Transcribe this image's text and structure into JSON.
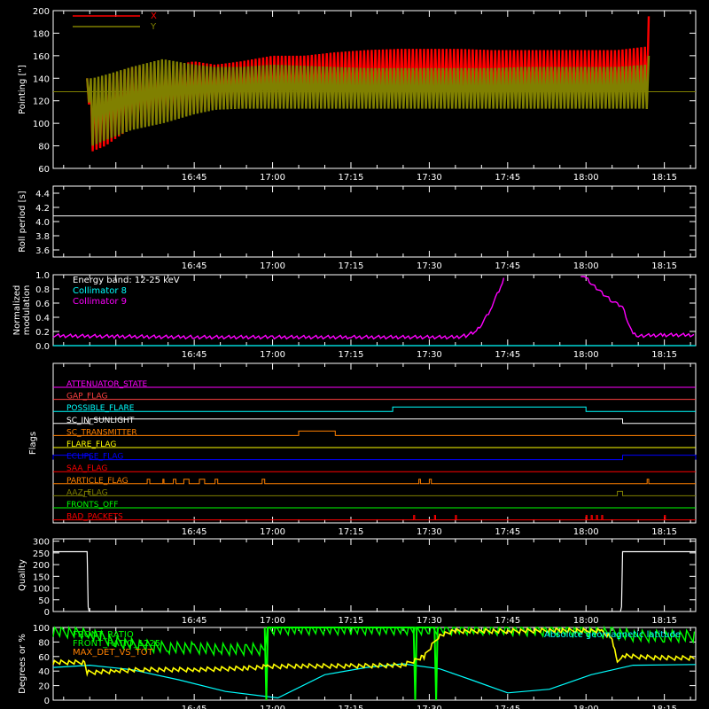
{
  "time_axis": {
    "range_min": [
      -27,
      96
    ],
    "ticks": [
      "16:45",
      "17:00",
      "17:15",
      "17:30",
      "17:45",
      "18:00",
      "18:15"
    ],
    "tick_min": [
      0,
      15,
      30,
      45,
      60,
      75,
      90
    ],
    "minor_step_min": 5
  },
  "colors": {
    "background": "#000000",
    "axes": "#ffffff",
    "x_pointing": "#ff0000",
    "y_pointing": "#808000",
    "cyan": "#00ffff",
    "magenta": "#ff00ff",
    "yellow": "#ffff00",
    "green": "#00ff00",
    "orange": "#ff8000"
  },
  "chart_data": [
    {
      "type": "line",
      "panel": "pointing",
      "ylabel": "Pointing [\"]",
      "ylim": [
        60,
        200
      ],
      "yticks": [
        60,
        80,
        100,
        120,
        140,
        160,
        180,
        200
      ],
      "legend_position": "top-left",
      "series": [
        {
          "name": "X",
          "color": "#ff0000",
          "envelope_x": [
            -20.5,
            -19.5,
            -17,
            -12,
            -6,
            0,
            4,
            9,
            15,
            21,
            27,
            33,
            39,
            45,
            51,
            57,
            63,
            69,
            75,
            81,
            86.5,
            87
          ],
          "envelope_upper": [
            140,
            130,
            140,
            150,
            150,
            155,
            152,
            155,
            160,
            160,
            163,
            165,
            166,
            166,
            166,
            165,
            165,
            165,
            165,
            165,
            168,
            195
          ],
          "envelope_lower": [
            140,
            75,
            80,
            96,
            105,
            110,
            115,
            116,
            117,
            118,
            118,
            118,
            119,
            119,
            119,
            119,
            119,
            118,
            117,
            118,
            118,
            112
          ],
          "baseline": 128
        },
        {
          "name": "Y",
          "color": "#808000",
          "envelope_x": [
            -20.5,
            -19.5,
            -17,
            -12,
            -6,
            0,
            4,
            9,
            15,
            21,
            27,
            33,
            39,
            45,
            51,
            57,
            63,
            69,
            75,
            81,
            86.5,
            87
          ],
          "envelope_upper": [
            140,
            140,
            143,
            150,
            157,
            152,
            150,
            150,
            152,
            151,
            150,
            149,
            149,
            149,
            149,
            149,
            150,
            150,
            150,
            150,
            152,
            160
          ],
          "envelope_lower": [
            140,
            80,
            85,
            94,
            100,
            108,
            112,
            113,
            113,
            113,
            113,
            113,
            113,
            113,
            113,
            113,
            113,
            113,
            113,
            113,
            113,
            112
          ],
          "baseline": 128
        }
      ]
    },
    {
      "type": "line",
      "panel": "roll_period",
      "ylabel": "Roll period [s]",
      "ylim": [
        3.5,
        4.5
      ],
      "yticks": [
        3.6,
        3.8,
        4.0,
        4.2,
        4.4
      ],
      "series": [
        {
          "color": "#ffffff",
          "x": [
            -27,
            96
          ],
          "y": [
            4.08,
            4.08
          ]
        }
      ]
    },
    {
      "type": "line",
      "panel": "modulation",
      "ylabel": "Normalized modulation",
      "ylim": [
        0,
        1.0
      ],
      "yticks": [
        0.0,
        0.2,
        0.4,
        0.6,
        0.8,
        1.0
      ],
      "annotations": [
        "Energy band: 12-25 keV"
      ],
      "legend_position": "top-left",
      "series": [
        {
          "name": "Collimator 8",
          "color": "#00ffff",
          "x": [
            -27,
            96
          ],
          "y": [
            0.0,
            0.0
          ]
        },
        {
          "name": "Collimator 9",
          "color": "#ff00ff",
          "segments": [
            {
              "x": [
                -27,
                -15,
                0,
                15,
                30,
                40,
                50,
                52,
                54,
                55,
                56,
                57,
                58,
                59,
                59.5
              ],
              "y": [
                0.14,
                0.13,
                0.12,
                0.12,
                0.12,
                0.12,
                0.12,
                0.14,
                0.2,
                0.3,
                0.42,
                0.55,
                0.72,
                0.88,
                1.0
              ]
            },
            {
              "x": [
                74,
                75,
                76,
                78,
                80,
                81,
                82,
                83,
                84,
                85,
                90,
                96
              ],
              "y": [
                1.0,
                0.95,
                0.88,
                0.75,
                0.62,
                0.58,
                0.55,
                0.35,
                0.16,
                0.14,
                0.15,
                0.15
              ]
            }
          ]
        }
      ]
    },
    {
      "type": "line",
      "panel": "flags",
      "ylabel": "Flags",
      "flags": [
        {
          "name": "ATTENUATOR_STATE",
          "color": "#ff00ff",
          "changes": []
        },
        {
          "name": "GAP_FLAG",
          "color": "#ff4040",
          "changes": []
        },
        {
          "name": "POSSIBLE_FLARE",
          "color": "#00ffff",
          "changes": [
            [
              38,
              75
            ]
          ]
        },
        {
          "name": "SC_IN_SUNLIGHT",
          "color": "#ffffff",
          "changes": [
            [
              -20,
              82
            ]
          ]
        },
        {
          "name": "SC_TRANSMITTER",
          "color": "#ff8000",
          "changes": [
            [
              20,
              27
            ]
          ]
        },
        {
          "name": "FLARE_FLAG",
          "color": "#ffff00",
          "changes": []
        },
        {
          "name": "ECLIPSE_FLAG",
          "color": "#0000ff",
          "changes": [
            [
              -27,
              -20
            ],
            [
              82,
              96
            ]
          ]
        },
        {
          "name": "SAA_FLAG",
          "color": "#ff0000",
          "changes": []
        },
        {
          "name": "PARTICLE_FLAG",
          "color": "#ff8000",
          "changes": [
            [
              -9,
              -8.5
            ],
            [
              -6,
              -5.8
            ],
            [
              -4,
              -3.5
            ],
            [
              -2,
              -1
            ],
            [
              1,
              2
            ],
            [
              4,
              4.5
            ],
            [
              13,
              13.5
            ],
            [
              43,
              43.3
            ],
            [
              45,
              45.4
            ],
            [
              86.7,
              87
            ]
          ]
        },
        {
          "name": "AAZ_FLAG",
          "color": "#808000",
          "changes": [
            [
              -21,
              -20
            ],
            [
              81,
              82
            ]
          ]
        },
        {
          "name": "FRONTS_OFF",
          "color": "#00ff00",
          "changes": []
        },
        {
          "name": "BAD_PACKETS",
          "color": "#ff0000",
          "changes": [
            [
              42,
              42.2
            ],
            [
              46,
              46.2
            ],
            [
              50,
              50.2
            ],
            [
              75,
              75.2
            ],
            [
              76,
              76.2
            ],
            [
              77,
              77.2
            ],
            [
              78,
              78.2
            ],
            [
              90,
              90.2
            ]
          ]
        }
      ]
    },
    {
      "type": "line",
      "panel": "quality",
      "ylabel": "Quality",
      "ylim": [
        0,
        310
      ],
      "yticks": [
        0,
        50,
        100,
        150,
        200,
        250,
        300
      ],
      "series": [
        {
          "color": "#ffffff",
          "x": [
            -27,
            -20.5,
            -20.3,
            -20.1,
            81.6,
            81.8,
            82,
            96
          ],
          "y": [
            255,
            255,
            20,
            0,
            0,
            20,
            255,
            255
          ]
        }
      ]
    },
    {
      "type": "line",
      "panel": "ratios",
      "ylabel": "Degrees or %",
      "ylim": [
        0,
        100
      ],
      "yticks": [
        0,
        20,
        40,
        60,
        80,
        100
      ],
      "legend_position": "top-left",
      "right_label": "Absolute geomagnetic latitude",
      "series": [
        {
          "name": "FRONT_RATIO",
          "color": "#00ff00",
          "x": [
            -27,
            -20,
            -15,
            -10,
            -5,
            0,
            5,
            10,
            13.5,
            14,
            20,
            30,
            40,
            45,
            50,
            55,
            60,
            65,
            70,
            75,
            80,
            85,
            90,
            96
          ],
          "y": [
            95,
            92,
            80,
            75,
            72,
            72,
            70,
            70,
            70,
            98,
            98,
            98,
            98,
            98,
            98,
            98,
            97,
            96,
            96,
            95,
            93,
            88,
            88,
            88
          ]
        },
        {
          "name": "FRONT_RATIO_1225",
          "color": "#00ff00",
          "x": [
            13.5,
            13.8,
            14.1,
            42,
            42.3,
            42.6,
            46,
            46.3,
            46.6
          ],
          "y": [
            100,
            0,
            100,
            100,
            0,
            100,
            100,
            0,
            100
          ]
        },
        {
          "name": "MAX_DET_VS_TOT",
          "color": "#ffff00",
          "x": [
            -27,
            -21,
            -20.5,
            -15,
            -10,
            0,
            10,
            14,
            20,
            30,
            40,
            44,
            47,
            50,
            60,
            70,
            78,
            80,
            81,
            82,
            84,
            90,
            96
          ],
          "y": [
            52,
            52,
            38,
            40,
            42,
            42,
            44,
            46,
            47,
            47,
            48,
            60,
            90,
            95,
            95,
            96,
            95,
            85,
            50,
            62,
            60,
            58,
            58
          ]
        },
        {
          "name": "Absolute geomagnetic latitude",
          "color": "#00ffff",
          "x": [
            -27,
            -20,
            -12,
            -3,
            6,
            16,
            25,
            33,
            40,
            47,
            53,
            60,
            68,
            76,
            84,
            96
          ],
          "y": [
            45,
            48,
            42,
            28,
            12,
            3,
            35,
            45,
            50,
            43,
            28,
            10,
            15,
            35,
            48,
            49
          ]
        }
      ]
    }
  ]
}
